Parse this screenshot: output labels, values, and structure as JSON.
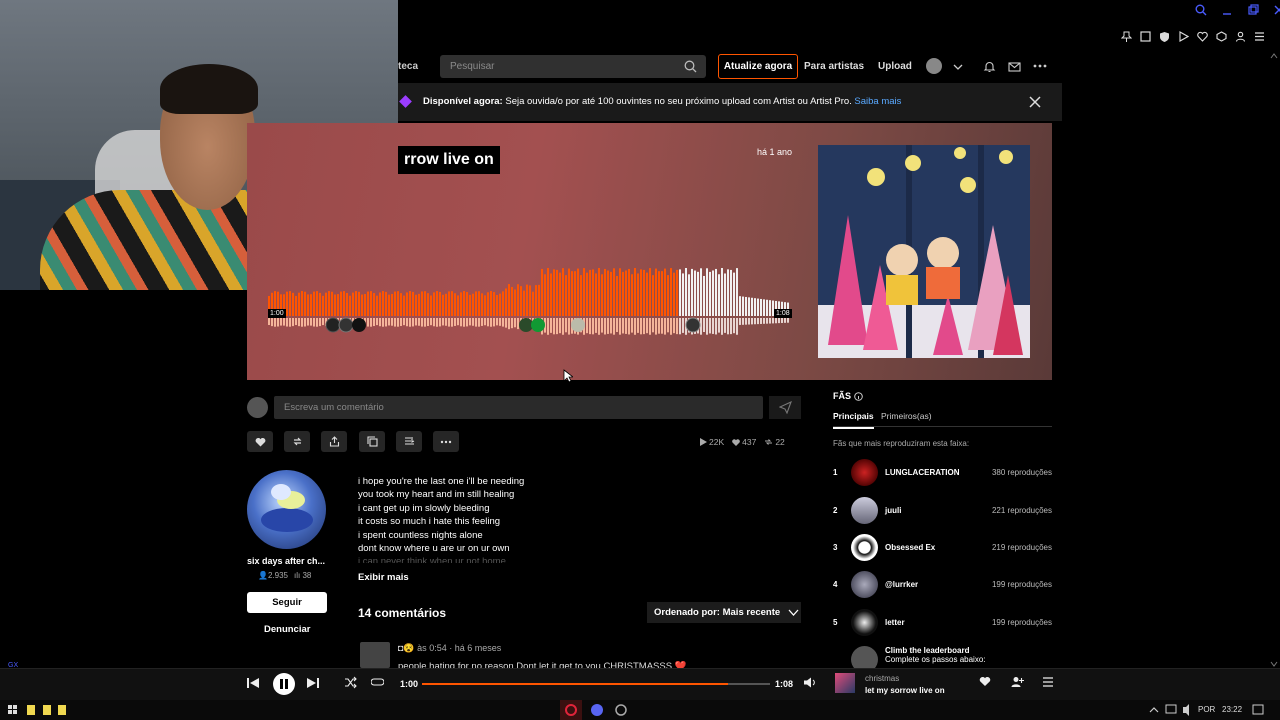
{
  "nav": {
    "library_partial": "teca",
    "search_placeholder": "Pesquisar",
    "upgrade_label": "Atualize agora",
    "for_artists_label": "Para artistas",
    "upload_label": "Upload"
  },
  "banner": {
    "bold": "Disponível agora:",
    "text": " Seja ouvida/o por até 100 ouvintes no seu próximo upload com Artist ou Artist Pro. ",
    "link": "Saiba mais"
  },
  "track": {
    "title_partial": "rrow live on",
    "posted": "há 1 ano",
    "time_start": "1:00",
    "time_end": "1:08",
    "progress_fraction": 0.88
  },
  "comment_box": {
    "placeholder": "Escreva um comentário"
  },
  "stats": {
    "plays": "22K",
    "likes": "437",
    "reposts": "22"
  },
  "artist": {
    "name": "six days after ch...",
    "followers": "2.935",
    "tracks": "38",
    "follow_label": "Seguir",
    "report_label": "Denunciar"
  },
  "lyrics": {
    "lines": [
      "i hope you're the last one i'll be needing",
      "you took my heart and im still healing",
      "i cant get up im slowly bleeding",
      "it costs so much i hate this feeling",
      "i spent countless nights alone",
      "dont know where u are ur on ur own"
    ],
    "faded_line": "i can never think when ur not home",
    "show_more": "Exibir mais"
  },
  "comments": {
    "count_label": "14 comentários",
    "sort_label": "Ordenado por: Mais recente",
    "first": {
      "user_emoji": "◘😵",
      "at_label": "às",
      "at_time": "0:54",
      "ago": " · há 6 meses",
      "text": "people hating for no reason Dont let it get to you CHRISTMASSS ❤️"
    }
  },
  "fans": {
    "title": "FÃS",
    "tab_top": "Principais",
    "tab_first": "Primeiros(as)",
    "subtitle": "Fãs que mais reproduziram esta faixa:",
    "list": [
      {
        "rank": "1",
        "name": "LUNGLACERATION",
        "plays": "380 reproduções"
      },
      {
        "rank": "2",
        "name": "juuli",
        "plays": "221 reproduções"
      },
      {
        "rank": "3",
        "name": "Obsessed Ex",
        "plays": "219 reproduções"
      },
      {
        "rank": "4",
        "name": "@lurrker",
        "plays": "199 reproduções"
      },
      {
        "rank": "5",
        "name": "letter",
        "plays": "199 reproduções"
      }
    ],
    "leader_title": "Climb the leaderboard",
    "leader_sub": "Complete os passos abaixo:"
  },
  "player": {
    "time_current": "1:00",
    "time_total": "1:08",
    "progress_fraction": 0.88,
    "now_artist": "christmas",
    "now_title": "let my sorrow live on"
  },
  "taskbar": {
    "lang": "POR",
    "clock": "23:22"
  },
  "side": {
    "gx": "GX"
  },
  "colors": {
    "accent": "#ff5500",
    "banner_link": "#5aa9ff"
  }
}
